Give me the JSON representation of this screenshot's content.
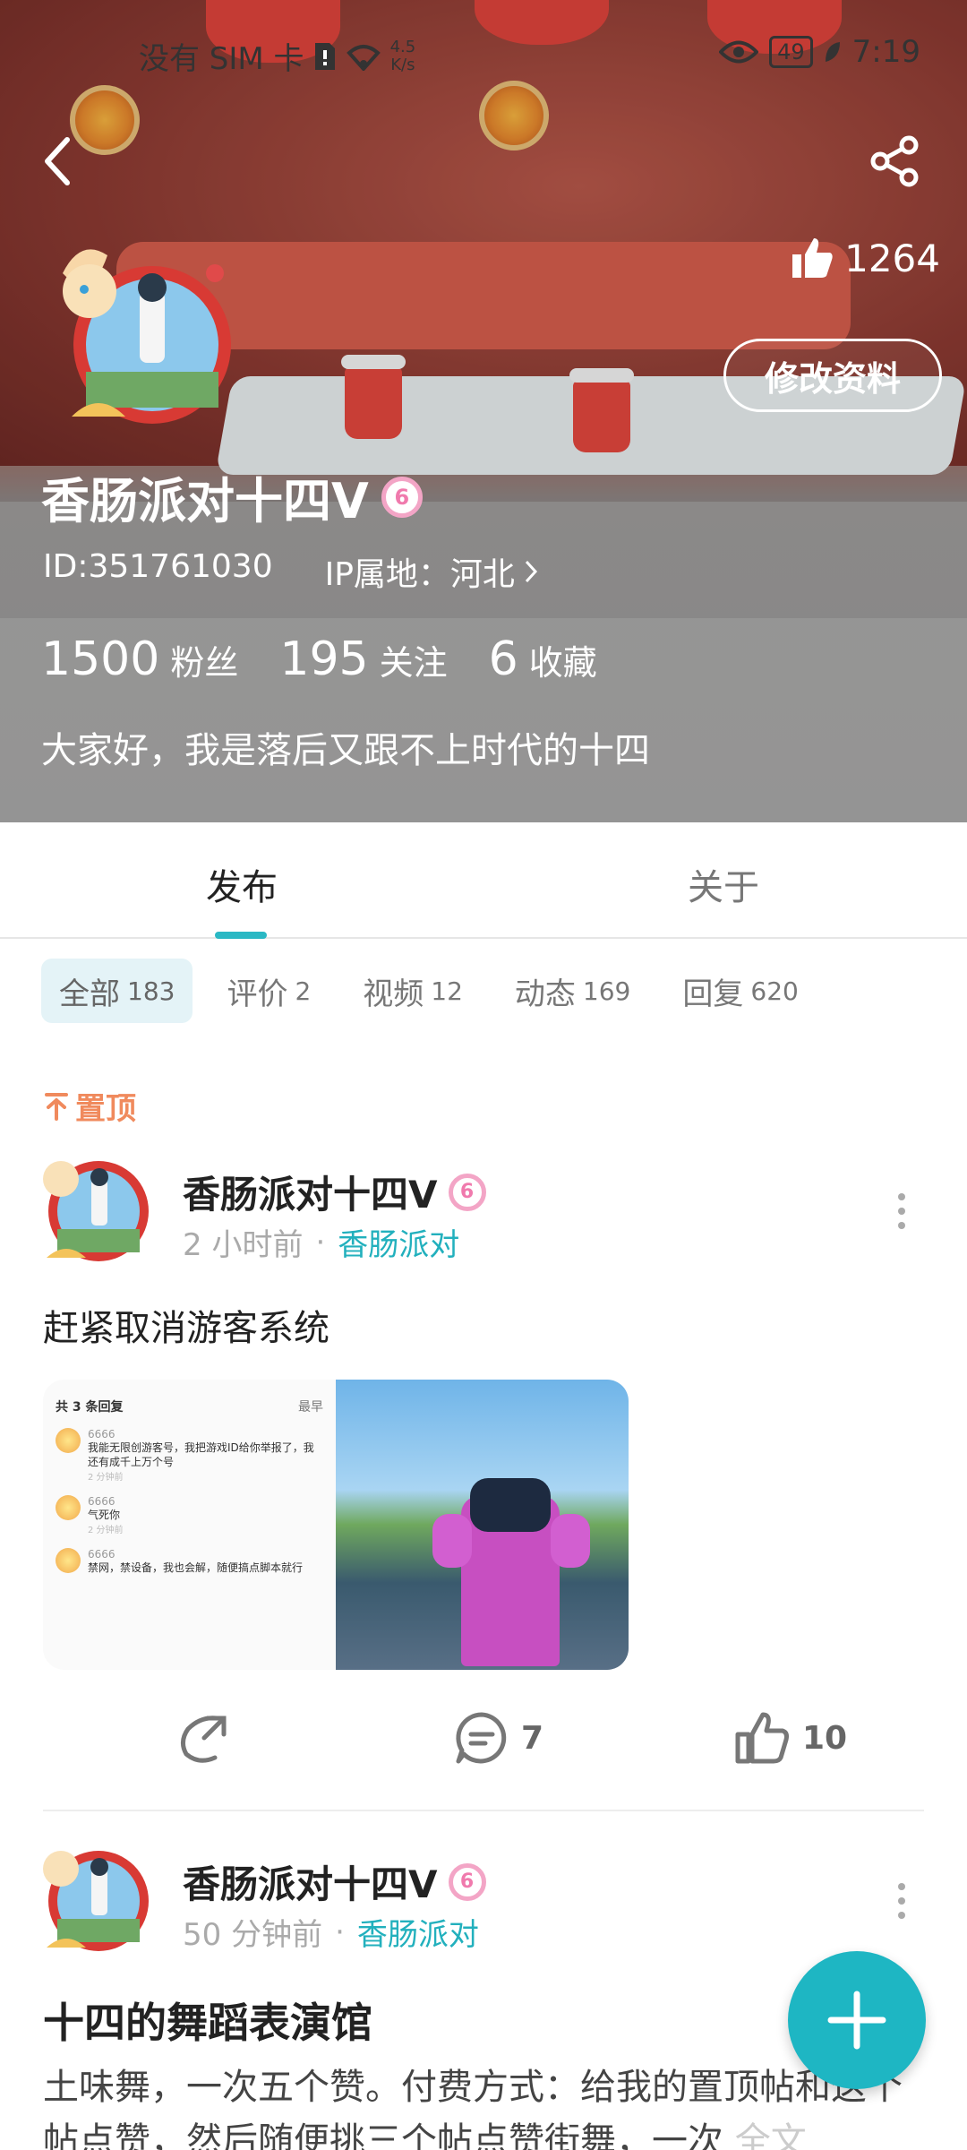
{
  "status_bar": {
    "carrier": "没有 SIM 卡",
    "speed_value": "4.5",
    "speed_unit": "K/s",
    "battery": "49",
    "time": "7:19"
  },
  "profile": {
    "likes": "1264",
    "edit_label": "修改资料",
    "name": "香肠派对十四V",
    "badge": "6",
    "id_text": "ID:351761030",
    "ip_text": "IP属地：河北",
    "fans_count": "1500",
    "fans_label": "粉丝",
    "following_count": "195",
    "following_label": "关注",
    "favorites_count": "6",
    "favorites_label": "收藏",
    "bio": "大家好，我是落后又跟不上时代的十四"
  },
  "tabs": {
    "publish": "发布",
    "about": "关于"
  },
  "filters": [
    {
      "label": "全部",
      "count": "183"
    },
    {
      "label": "评价",
      "count": "2"
    },
    {
      "label": "视频",
      "count": "12"
    },
    {
      "label": "动态",
      "count": "169"
    },
    {
      "label": "回复",
      "count": "620"
    }
  ],
  "pinned_label": "置顶",
  "post1": {
    "author": "香肠派对十四V",
    "time": "2 小时前",
    "channel": "香肠派对",
    "text": "赶紧取消游客系统",
    "image_left": {
      "header": "共 3 条回复",
      "sort": "最早",
      "comments": [
        {
          "name": "6666",
          "text": "我能无限创游客号，我把游戏ID给你举报了，我还有成千上万个号",
          "time": "2 分钟前"
        },
        {
          "name": "6666",
          "text": "气死你",
          "time": "2 分钟前"
        },
        {
          "name": "6666",
          "text": "禁网，禁设备，我也会解，随便搞点脚本就行",
          "time": ""
        }
      ]
    },
    "comments": "7",
    "likes": "10"
  },
  "post2": {
    "author": "香肠派对十四V",
    "time": "50 分钟前",
    "channel": "香肠派对",
    "title": "十四的舞蹈表演馆",
    "body": "土味舞，一次五个赞。付费方式：给我的置顶帖和这个帖点赞，然后随便挑三个帖点赞街舞，一次",
    "more": "全文"
  },
  "colors": {
    "accent": "#1eb6c3",
    "pinned": "#f08a5d"
  }
}
